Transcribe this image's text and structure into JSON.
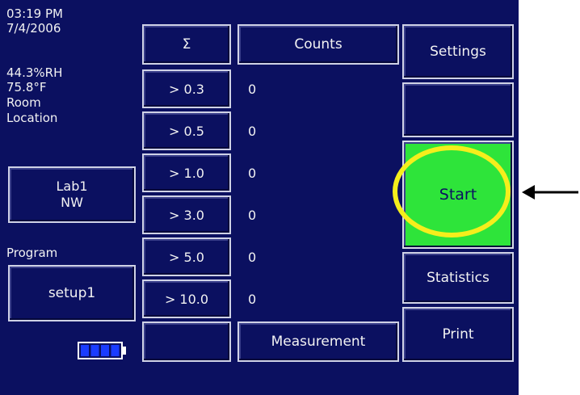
{
  "status": {
    "time": "03:19 PM",
    "date": "7/4/2006",
    "humidity": "44.3%RH",
    "temperature": "75.8°F",
    "room_label": "Room",
    "location_label": "Location",
    "location_line1": "Lab1",
    "location_line2": "NW",
    "program_label": "Program",
    "program_value": "setup1"
  },
  "table": {
    "sum_header": "Σ",
    "counts_header": "Counts",
    "rows": [
      {
        "size": "> 0.3",
        "count": "0"
      },
      {
        "size": "> 0.5",
        "count": "0"
      },
      {
        "size": "> 1.0",
        "count": "0"
      },
      {
        "size": "> 3.0",
        "count": "0"
      },
      {
        "size": "> 5.0",
        "count": "0"
      },
      {
        "size": "> 10.0",
        "count": "0"
      }
    ],
    "blank_footer": "",
    "measurement_button": "Measurement"
  },
  "actions": {
    "settings": "Settings",
    "blank": "",
    "start": "Start",
    "statistics": "Statistics",
    "print": "Print"
  },
  "battery": {
    "level": 1.0
  },
  "colors": {
    "screen_bg": "#0b1060",
    "start_green": "#2ee43a",
    "highlight_yellow": "#f5ee1c"
  }
}
